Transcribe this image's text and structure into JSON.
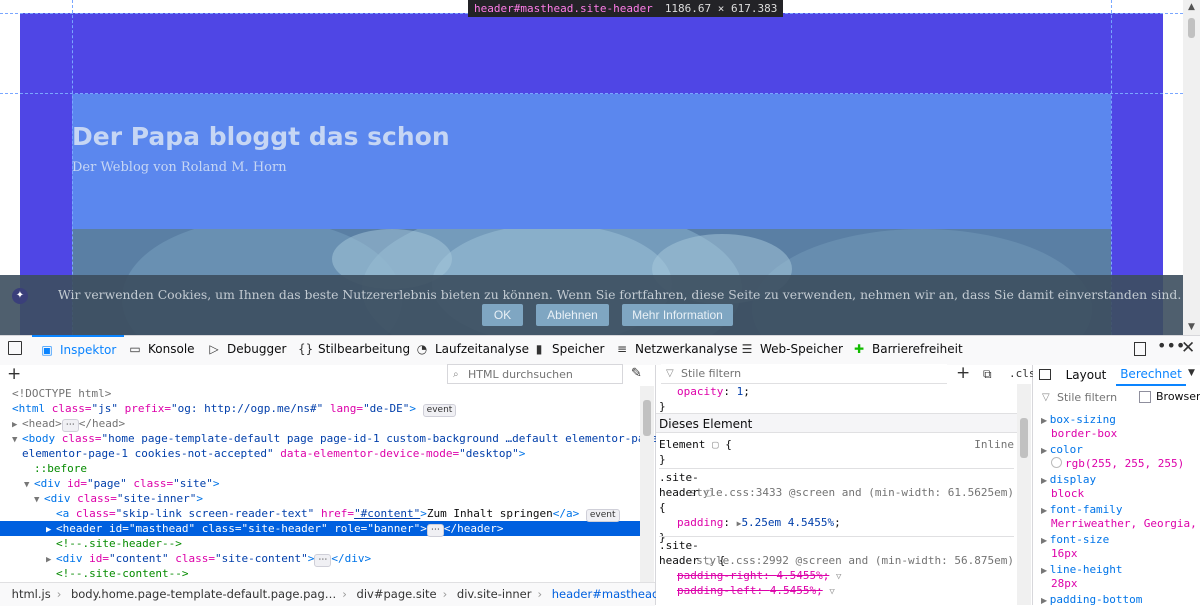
{
  "page": {
    "site_title": "Der Papa bloggt das schon",
    "site_description": "Der Weblog von Roland M. Horn",
    "highlighter": {
      "tag": "header#masthead.site-header",
      "dims": "1186.67 × 617.383"
    },
    "cookie": {
      "text": "Wir verwenden Cookies, um Ihnen das beste Nutzererlebnis bieten zu können. Wenn Sie fortfahren, diese Seite zu verwenden, nehmen wir an, dass Sie damit einverstanden sind.",
      "ok": "OK",
      "decline": "Ablehnen",
      "more": "Mehr Information"
    }
  },
  "toolbar": {
    "tabs": [
      {
        "label": "Inspektor",
        "icon": "inspector-icon"
      },
      {
        "label": "Konsole",
        "icon": "console-icon"
      },
      {
        "label": "Debugger",
        "icon": "debugger-icon"
      },
      {
        "label": "Stilbearbeitung",
        "icon": "style-editor-icon"
      },
      {
        "label": "Laufzeitanalyse",
        "icon": "performance-icon"
      },
      {
        "label": "Speicher",
        "icon": "memory-icon"
      },
      {
        "label": "Netzwerkanalyse",
        "icon": "network-icon"
      },
      {
        "label": "Web-Speicher",
        "icon": "storage-icon"
      },
      {
        "label": "Barrierefreiheit",
        "icon": "accessibility-icon"
      }
    ],
    "active_tab": "Inspektor"
  },
  "markup": {
    "search_placeholder": "HTML durchsuchen",
    "lines": {
      "doctype": "<!DOCTYPE html>",
      "html_tag": "<html",
      "html_class_attr": "class=",
      "html_class_val": "\"js\"",
      "html_prefix_attr": "prefix=",
      "html_prefix_val": "\"og: http://ogp.me/ns#\"",
      "html_lang_attr": "lang=",
      "html_lang_val": "\"de-DE\"",
      "html_close": ">",
      "head": "<head>",
      "head_close": "</head>",
      "body_tag": "<body",
      "body_class_attr": "class=",
      "body_class_val": "\"home page-template-default page page-id-1 custom-background …default elementor-page",
      "body_class_val2": "elementor-page-1 cookies-not-accepted\"",
      "body_device_attr": "data-elementor-device-mode=",
      "body_device_val": "\"desktop\"",
      "body_close": ">",
      "before": "::before",
      "div_page": "<div",
      "div_page_id_attr": "id=",
      "div_page_id_val": "\"page\"",
      "div_page_class_attr": "class=",
      "div_page_class_val": "\"site\"",
      "div_inner": "<div",
      "div_inner_class_attr": "class=",
      "div_inner_class_val": "\"site-inner\"",
      "a_tag": "<a",
      "a_class_attr": "class=",
      "a_class_val": "\"skip-link screen-reader-text\"",
      "a_href_attr": "href=",
      "a_href_val": "\"#content\"",
      "a_text": "Zum Inhalt springen",
      "a_close": "</a>",
      "header_tag": "<header",
      "header_id_attr": "id=",
      "header_id_val": "\"masthead\"",
      "header_class_attr": "class=",
      "header_class_val": "\"site-header\"",
      "header_role_attr": "role=",
      "header_role_val": "\"banner\"",
      "header_close": "</header>",
      "comment1": "<!--.site-header-->",
      "div_content": "<div",
      "div_content_id_attr": "id=",
      "div_content_id_val": "\"content\"",
      "div_content_class_attr": "class=",
      "div_content_class_val": "\"site-content\"",
      "div_content_close": "</div>",
      "comment2": "<!--.site-content-->"
    },
    "event_badge": "event"
  },
  "breadcrumbs": [
    "html.js",
    "body.home.page-template-default.page.pag…",
    "div#page.site",
    "div.site-inner",
    "header#masthead.site-header"
  ],
  "rules": {
    "filter_placeholder": "Stile filtern",
    "cls_label": ".cls",
    "top_prop": "opacity",
    "top_val": "1",
    "section_title": "Dieses Element",
    "element_label": "Element",
    "inline_label": "Inline",
    "rule1": {
      "selector_a": ".site-",
      "selector_b": "header",
      "source": "style.css:3433 @screen and (min-width: 61.5625em)",
      "prop": "padding",
      "val": "5.25em 4.5455%"
    },
    "rule2": {
      "selector_a": ".site-",
      "selector_b": "header",
      "source": "style.css:2992 @screen and (min-width: 56.875em)",
      "prop1": "padding-right",
      "val1": "4.5455%",
      "prop2": "padding-left",
      "val2": "4.5455%"
    }
  },
  "computed": {
    "tabs": [
      "Layout",
      "Berechnet"
    ],
    "active_tab": "Berechnet",
    "filter_placeholder": "Stile filtern",
    "browser_styles": "Browser-S",
    "props": [
      {
        "name": "box-sizing",
        "value": "border-box"
      },
      {
        "name": "color",
        "value": "rgb(255, 255, 255)"
      },
      {
        "name": "display",
        "value": "block"
      },
      {
        "name": "font-family",
        "value": "Merriweather, Georgia, se…"
      },
      {
        "name": "font-size",
        "value": "16px"
      },
      {
        "name": "line-height",
        "value": "28px"
      },
      {
        "name": "padding-bottom",
        "value": ""
      }
    ]
  },
  "colors": {
    "masthead": "#4f46e5",
    "branding": "#5b87ee",
    "selection": "#0060df",
    "accent": "#0a84ff"
  }
}
